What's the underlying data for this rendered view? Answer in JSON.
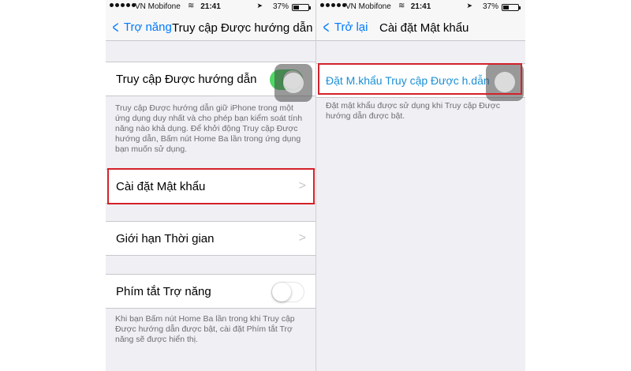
{
  "status": {
    "carrier": "VN Mobifone",
    "time": "21:41",
    "battery": "37%"
  },
  "left": {
    "nav": {
      "back_label": "Trợ năng",
      "title": "Truy cập Được hướng dẫn"
    },
    "guided_access": {
      "label": "Truy cập Được hướng dẫn",
      "enabled": true
    },
    "guided_access_footer": "Truy cập Được hướng dẫn giữ iPhone trong một ứng dụng duy nhất và cho phép bạn kiểm soát tính năng nào khả dụng. Để khởi động Truy cập Được hướng dẫn, Bấm nút Home Ba lần trong ứng dụng bạn muốn sử dụng.",
    "passcode_settings": {
      "label": "Cài đặt Mật khẩu"
    },
    "time_limits": {
      "label": "Giới hạn Thời gian"
    },
    "accessibility_shortcut": {
      "label": "Phím tắt Trợ năng",
      "enabled": false
    },
    "shortcut_footer": "Khi bạn Bấm nút Home Ba lần trong khi Truy cập Được hướng dẫn được bật, cài đặt Phím tắt Trợ năng sẽ được hiển thị."
  },
  "right": {
    "nav": {
      "back_label": "Trở lại",
      "title": "Cài đặt Mật khẩu"
    },
    "set_passcode": {
      "label": "Đặt M.khẩu Truy cập Được h.dẫn"
    },
    "set_passcode_footer": "Đặt mật khẩu được sử dụng khi Truy cập Được hướng dẫn được bật."
  },
  "colors": {
    "accent": "#007aff",
    "toggle_on": "#4cd964",
    "highlight": "#d3222a",
    "background": "#efeff4"
  }
}
